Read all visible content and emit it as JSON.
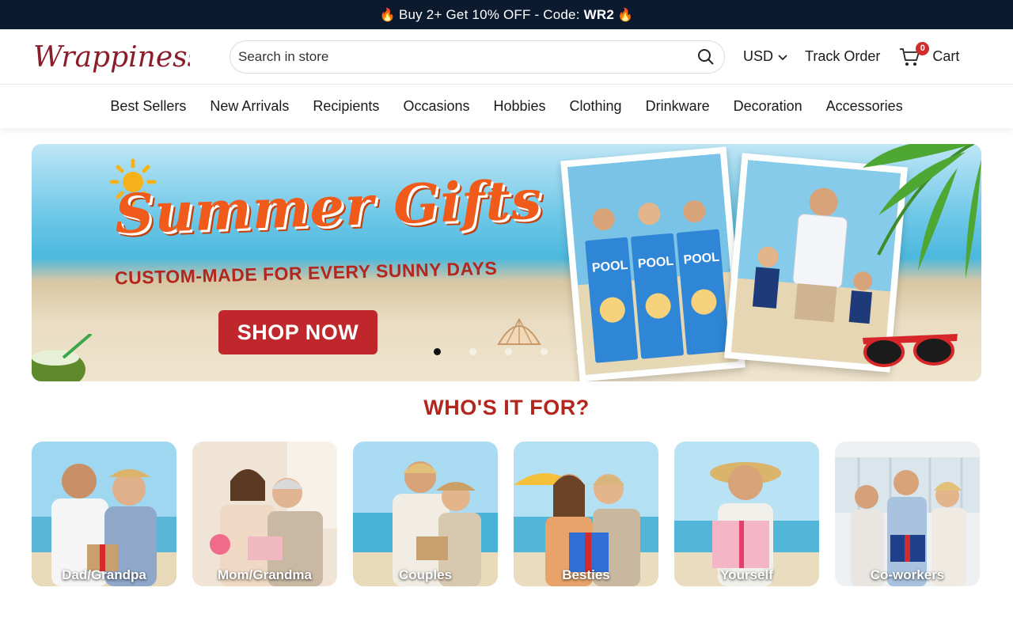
{
  "promo": {
    "prefix": "Buy 2+ Get 10% OFF - Code:",
    "code": "WR2"
  },
  "header": {
    "logo_text": "Wrappiness",
    "search_placeholder": "Search in store",
    "currency": "USD",
    "track_order": "Track Order",
    "cart_label": "Cart",
    "cart_count": "0"
  },
  "nav": [
    "Best Sellers",
    "New Arrivals",
    "Recipients",
    "Occasions",
    "Hobbies",
    "Clothing",
    "Drinkware",
    "Decoration",
    "Accessories"
  ],
  "hero": {
    "headline": "Summer Gifts",
    "subheadline": "CUSTOM-MADE FOR EVERY SUNNY DAYS",
    "cta": "SHOP NOW",
    "slide_count": 5,
    "active_slide": 0,
    "towel_label": "POOL"
  },
  "section": {
    "title": "WHO'S IT FOR?",
    "cards": [
      "Dad/Grandpa",
      "Mom/Grandma",
      "Couples",
      "Besties",
      "Yourself",
      "Co-workers"
    ]
  },
  "colors": {
    "promo_bg": "#0c1a30",
    "brand_red": "#b3261e",
    "cta_red": "#c0272d",
    "headline_orange": "#f05a1a"
  }
}
